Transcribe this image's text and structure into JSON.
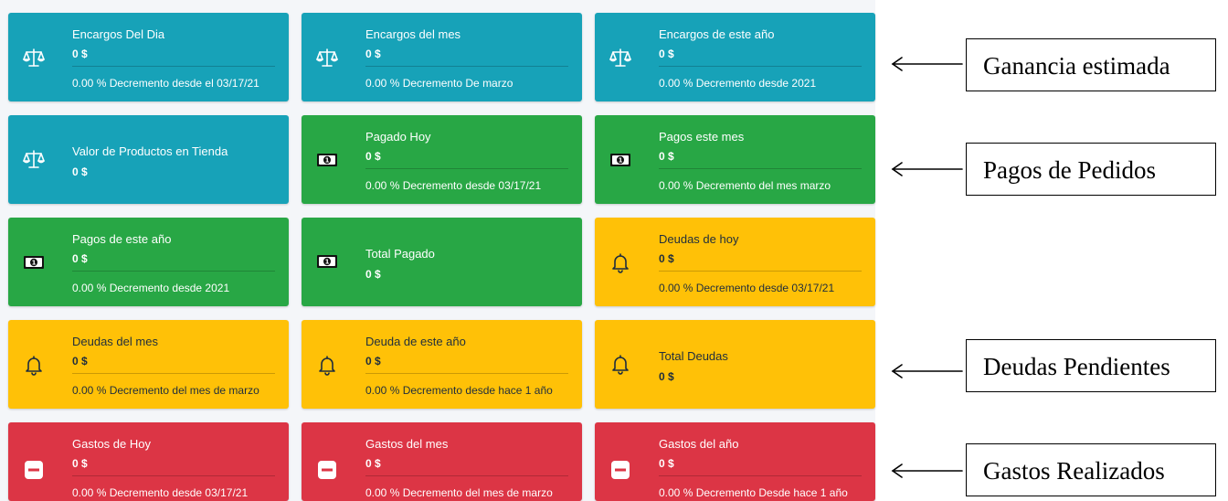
{
  "cards": [
    {
      "title": "Encargos Del Dia",
      "value": "0 $",
      "footer": "0.00 % Decremento desde el 03/17/21",
      "icon": "scale-icon",
      "color": "#17a2b8"
    },
    {
      "title": "Encargos del mes",
      "value": "0 $",
      "footer": "0.00 % Decremento De marzo",
      "icon": "scale-icon",
      "color": "#17a2b8"
    },
    {
      "title": "Encargos de este año",
      "value": "0 $",
      "footer": "0.00 % Decremento desde 2021",
      "icon": "scale-icon",
      "color": "#17a2b8"
    },
    {
      "title": "Valor de Productos en Tienda",
      "value": "0 $",
      "icon": "scale-icon",
      "color": "#17a2b8"
    },
    {
      "title": "Pagado Hoy",
      "value": "0 $",
      "footer": "0.00 % Decremento desde 03/17/21",
      "icon": "money-bill-icon",
      "color": "#28a745"
    },
    {
      "title": "Pagos este mes",
      "value": "0 $",
      "footer": "0.00 % Decremento del mes marzo",
      "icon": "money-bill-icon",
      "color": "#28a745"
    },
    {
      "title": "Pagos de este año",
      "value": "0 $",
      "footer": "0.00 % Decremento desde 2021",
      "icon": "money-bill-icon",
      "color": "#28a745"
    },
    {
      "title": "Total Pagado",
      "value": "0 $",
      "icon": "money-bill-icon",
      "color": "#28a745"
    },
    {
      "title": "Deudas de hoy",
      "value": "0 $",
      "footer": "0.00 % Decremento desde 03/17/21",
      "icon": "bell-icon",
      "color": "#ffc107"
    },
    {
      "title": "Deudas del mes",
      "value": "0 $",
      "footer": "0.00 % Decremento del mes de marzo",
      "icon": "bell-icon",
      "color": "#ffc107"
    },
    {
      "title": "Deuda de este año",
      "value": "0 $",
      "footer": "0.00 % Decremento desde hace 1 año",
      "icon": "bell-icon",
      "color": "#ffc107"
    },
    {
      "title": "Total Deudas",
      "value": "0 $",
      "icon": "bell-icon",
      "color": "#ffc107"
    },
    {
      "title": "Gastos de Hoy",
      "value": "0 $",
      "footer": "0.00 % Decremento desde 03/17/21",
      "icon": "minus-square-icon",
      "color": "#dc3545"
    },
    {
      "title": "Gastos del mes",
      "value": "0 $",
      "footer": "0.00 % Decremento del mes de marzo",
      "icon": "minus-square-icon",
      "color": "#dc3545"
    },
    {
      "title": "Gastos del año",
      "value": "0 $",
      "footer": "0.00 % Decremento Desde hace 1 año",
      "icon": "minus-square-icon",
      "color": "#dc3545"
    }
  ],
  "annotations": [
    {
      "label": "Ganancia estimada"
    },
    {
      "label": "Pagos de Pedidos"
    },
    {
      "label": "Deudas Pendientes"
    },
    {
      "label": "Gastos Realizados"
    }
  ]
}
